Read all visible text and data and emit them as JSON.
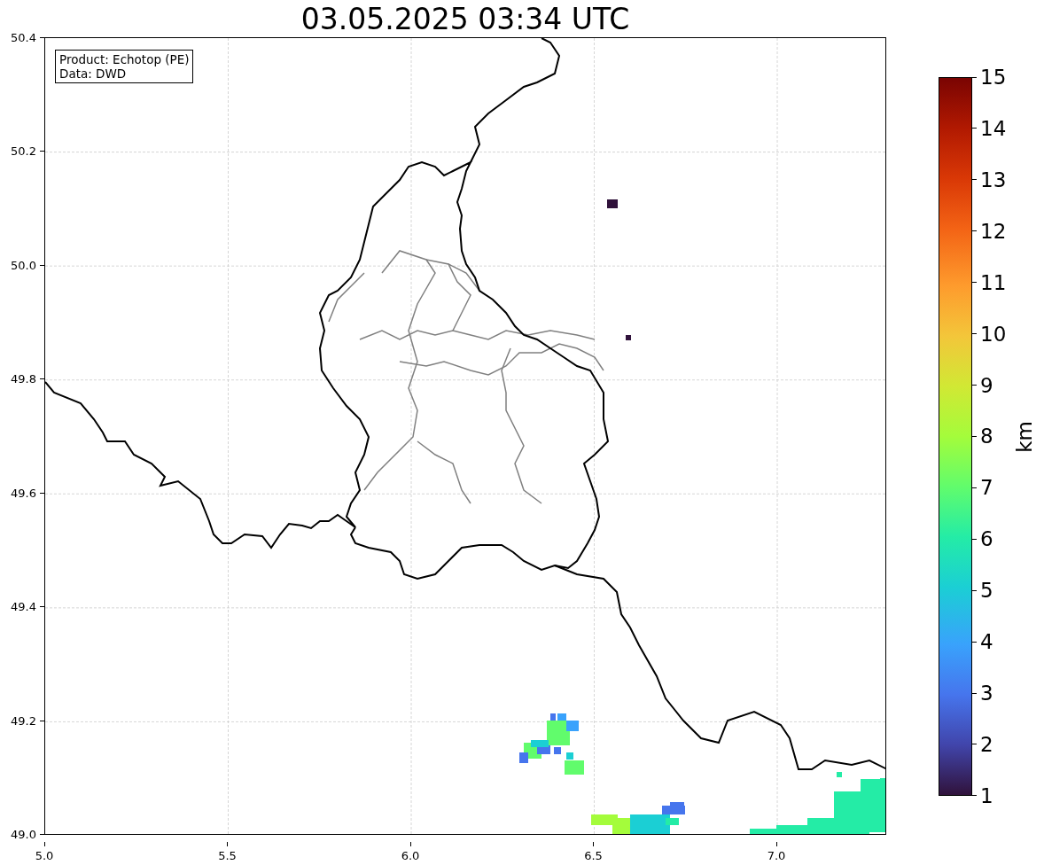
{
  "title": "03.05.2025 03:34 UTC",
  "info_box": [
    "Product: Echotop (PE)",
    "Data: DWD"
  ],
  "y_ticks": [
    "50.4",
    "50.2",
    "50.0",
    "49.8",
    "49.6",
    "49.4",
    "49.2",
    "49.0"
  ],
  "x_ticks": [
    "5.0",
    "5.5",
    "6.0",
    "6.5",
    "7.0"
  ],
  "colorbar": {
    "label": "km",
    "ticks": [
      "15",
      "14",
      "13",
      "12",
      "11",
      "10",
      "9",
      "8",
      "7",
      "6",
      "5",
      "4",
      "3",
      "2",
      "1"
    ]
  }
}
